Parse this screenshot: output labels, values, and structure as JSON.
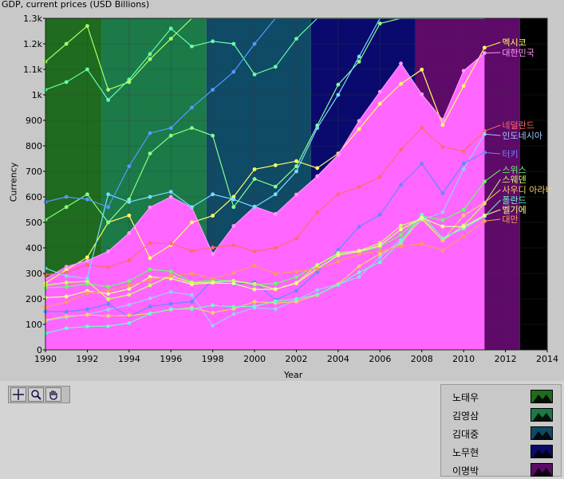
{
  "chart_data": {
    "type": "line",
    "title": "GDP, current prices (USD Billions)",
    "xlabel": "Year",
    "ylabel": "Currency",
    "xlim": [
      1990,
      2014
    ],
    "ylim": [
      0,
      1300
    ],
    "x_ticks": [
      "1990",
      "1992",
      "1994",
      "1996",
      "1998",
      "2000",
      "2002",
      "2004",
      "2006",
      "2008",
      "2010",
      "2012",
      "2014"
    ],
    "y_ticks": [
      "0",
      "100",
      "200",
      "300",
      "400",
      "500",
      "600",
      "700",
      "800",
      "900",
      "1k",
      "1.1k",
      "1.2k",
      "1.3k"
    ],
    "grid": true,
    "background_periods": [
      {
        "name": "노태우",
        "start": 1990,
        "end": 1992.7,
        "color": "#1f6b1f"
      },
      {
        "name": "김영삼",
        "start": 1992.7,
        "end": 1997.7,
        "color": "#1b7a48"
      },
      {
        "name": "김대중",
        "start": 1997.7,
        "end": 2002.7,
        "color": "#0f4a66"
      },
      {
        "name": "노무현",
        "start": 2002.7,
        "end": 2007.7,
        "color": "#0a0a6e"
      },
      {
        "name": "이명박",
        "start": 2007.7,
        "end": 2012.7,
        "color": "#5e0a68"
      },
      {
        "name": "",
        "start": 2012.7,
        "end": 2014,
        "color": "#000000"
      }
    ],
    "area_series": {
      "name": "대한민국",
      "color": "#ff66ff",
      "x": [
        1990,
        1991,
        1992,
        1993,
        1994,
        1995,
        1996,
        1997,
        1998,
        1999,
        2000,
        2001,
        2002,
        2003,
        2004,
        2005,
        2006,
        2007,
        2008,
        2009,
        2010,
        2011
      ],
      "values": [
        279,
        326,
        350,
        386,
        458,
        559,
        600,
        558,
        376,
        486,
        562,
        533,
        609,
        681,
        765,
        898,
        1012,
        1123,
        1002,
        902,
        1094,
        1164
      ]
    },
    "series": [
      {
        "name": "멕시코",
        "color": "#ffff66",
        "x": [
          1990,
          1991,
          1992,
          1993,
          1994,
          1995,
          1996,
          1997,
          1998,
          1999,
          2000,
          2001,
          2002,
          2003,
          2004,
          2005,
          2006,
          2007,
          2008,
          2009,
          2010,
          2011
        ],
        "values": [
          262,
          314,
          363,
          500,
          527,
          360,
          411,
          500,
          526,
          600,
          708,
          724,
          740,
          713,
          770,
          866,
          965,
          1043,
          1099,
          882,
          1035,
          1185
        ]
      },
      {
        "name": "대한민국",
        "color": "#ff99ff",
        "x": [
          1990,
          1991,
          1992,
          1993,
          1994,
          1995,
          1996,
          1997,
          1998,
          1999,
          2000,
          2001,
          2002,
          2003,
          2004,
          2005,
          2006,
          2007,
          2008,
          2009,
          2010,
          2011
        ],
        "values": [
          279,
          326,
          350,
          386,
          458,
          559,
          600,
          558,
          376,
          486,
          562,
          533,
          609,
          681,
          765,
          898,
          1012,
          1123,
          1002,
          902,
          1094,
          1164
        ]
      },
      {
        "name": "네덜란드",
        "color": "#ff6a6a",
        "x": [
          1990,
          1991,
          1992,
          1993,
          1994,
          1995,
          1996,
          1997,
          1998,
          1999,
          2000,
          2001,
          2002,
          2003,
          2004,
          2005,
          2006,
          2007,
          2008,
          2009,
          2010,
          2011
        ],
        "values": [
          295,
          303,
          333,
          324,
          351,
          419,
          417,
          388,
          401,
          411,
          386,
          400,
          437,
          539,
          610,
          639,
          678,
          785,
          871,
          796,
          779,
          858
        ]
      },
      {
        "name": "인도네시아",
        "color": "#99ccff",
        "x": [
          1990,
          1991,
          1992,
          1993,
          1994,
          1995,
          1996,
          1997,
          1998,
          1999,
          2000,
          2001,
          2002,
          2003,
          2004,
          2005,
          2006,
          2007,
          2008,
          2009,
          2010,
          2011
        ],
        "values": [
          114,
          128,
          139,
          158,
          177,
          202,
          227,
          215,
          95,
          140,
          165,
          160,
          196,
          235,
          257,
          286,
          364,
          432,
          510,
          540,
          709,
          846
        ]
      },
      {
        "name": "터키",
        "color": "#6688ff",
        "x": [
          1990,
          1991,
          1992,
          1993,
          1994,
          1995,
          1996,
          1997,
          1998,
          1999,
          2000,
          2001,
          2002,
          2003,
          2004,
          2005,
          2006,
          2007,
          2008,
          2009,
          2010,
          2011
        ],
        "values": [
          150,
          150,
          159,
          180,
          131,
          170,
          181,
          189,
          275,
          256,
          266,
          196,
          232,
          305,
          392,
          483,
          530,
          647,
          730,
          614,
          731,
          774
        ]
      },
      {
        "name": "스위스",
        "color": "#66ff66",
        "x": [
          1990,
          1991,
          1992,
          1993,
          1994,
          1995,
          1996,
          1997,
          1998,
          1999,
          2000,
          2001,
          2002,
          2003,
          2004,
          2005,
          2006,
          2007,
          2008,
          2009,
          2010,
          2011
        ],
        "values": [
          244,
          247,
          259,
          248,
          270,
          316,
          308,
          265,
          274,
          270,
          256,
          260,
          286,
          334,
          374,
          384,
          404,
          451,
          524,
          509,
          550,
          660
        ]
      },
      {
        "name": "스웨덴",
        "color": "#ccff66",
        "x": [
          1990,
          1991,
          1992,
          1993,
          1994,
          1995,
          1996,
          1997,
          1998,
          1999,
          2000,
          2001,
          2002,
          2003,
          2004,
          2005,
          2006,
          2007,
          2008,
          2009,
          2010,
          2011
        ],
        "values": [
          253,
          264,
          269,
          199,
          216,
          253,
          291,
          263,
          266,
          271,
          259,
          238,
          263,
          332,
          380,
          389,
          419,
          487,
          513,
          429,
          488,
          574
        ]
      },
      {
        "name": "사우디 아라비",
        "color": "#ffcc66",
        "x": [
          1990,
          1991,
          1992,
          1993,
          1994,
          1995,
          1996,
          1997,
          1998,
          1999,
          2000,
          2001,
          2002,
          2003,
          2004,
          2005,
          2006,
          2007,
          2008,
          2009,
          2010,
          2011
        ],
        "values": [
          117,
          132,
          137,
          133,
          135,
          143,
          158,
          165,
          146,
          161,
          189,
          184,
          189,
          215,
          258,
          328,
          377,
          416,
          520,
          429,
          527,
          577
        ]
      },
      {
        "name": "폴란드",
        "color": "#66ffcc",
        "x": [
          1990,
          1991,
          1992,
          1993,
          1994,
          1995,
          1996,
          1997,
          1998,
          1999,
          2000,
          2001,
          2002,
          2003,
          2004,
          2005,
          2006,
          2007,
          2008,
          2009,
          2010,
          2011
        ],
        "values": [
          65,
          85,
          92,
          93,
          105,
          142,
          160,
          160,
          175,
          169,
          171,
          191,
          199,
          217,
          255,
          304,
          344,
          425,
          530,
          438,
          476,
          524
        ]
      },
      {
        "name": "벨기에",
        "color": "#eeff88",
        "x": [
          1990,
          1991,
          1992,
          1993,
          1994,
          1995,
          1996,
          1997,
          1998,
          1999,
          2000,
          2001,
          2002,
          2003,
          2004,
          2005,
          2006,
          2007,
          2008,
          2009,
          2010,
          2011
        ],
        "values": [
          205,
          209,
          231,
          220,
          239,
          286,
          280,
          257,
          263,
          260,
          237,
          238,
          261,
          318,
          371,
          386,
          409,
          472,
          518,
          484,
          483,
          527
        ]
      },
      {
        "name": "대만",
        "color": "#ff9966",
        "x": [
          1990,
          1991,
          1992,
          1993,
          1994,
          1995,
          1996,
          1997,
          1998,
          1999,
          2000,
          2001,
          2002,
          2003,
          2004,
          2005,
          2006,
          2007,
          2008,
          2009,
          2010,
          2011
        ],
        "values": [
          167,
          187,
          222,
          233,
          253,
          275,
          290,
          300,
          279,
          303,
          331,
          299,
          307,
          317,
          346,
          375,
          388,
          406,
          416,
          390,
          446,
          505
        ]
      },
      {
        "name": "",
        "color": "#88ff88",
        "x": [
          1990,
          1991,
          1992,
          1993,
          1994,
          1995,
          1996,
          1997,
          1998,
          1999,
          2000,
          2001,
          2002,
          2003,
          2004,
          2005,
          2006,
          2007,
          2008,
          2009,
          2010,
          2011
        ],
        "values": [
          510,
          560,
          610,
          500,
          590,
          770,
          840,
          870,
          840,
          560,
          670,
          640,
          720,
          880,
          1040,
          1130,
          1280,
          1300,
          1300,
          1300,
          1300,
          1300
        ]
      },
      {
        "name": "",
        "color": "#77ddff",
        "x": [
          1990,
          1991,
          1992,
          1993,
          1994,
          1995,
          1996,
          1997,
          1998,
          1999,
          2000,
          2001,
          2002,
          2003,
          2004,
          2005,
          2006,
          2007,
          2008,
          2009,
          2010,
          2011
        ],
        "values": [
          320,
          290,
          280,
          610,
          580,
          600,
          620,
          560,
          610,
          590,
          560,
          610,
          700,
          870,
          1000,
          1150,
          1300,
          1300,
          1300,
          1300,
          1300,
          1300
        ]
      },
      {
        "name": "",
        "color": "#66ffaa",
        "x": [
          1990,
          1991,
          1992,
          1993,
          1994,
          1995,
          1996,
          1997,
          1998,
          1999,
          2000,
          2001,
          2002,
          2003,
          2004,
          2005,
          2006,
          2007,
          2008,
          2009,
          2010,
          2011
        ],
        "values": [
          1020,
          1050,
          1100,
          980,
          1060,
          1160,
          1260,
          1190,
          1210,
          1200,
          1080,
          1110,
          1220,
          1300,
          1300,
          1300,
          1300,
          1300,
          1300,
          1300,
          1300,
          1300
        ]
      },
      {
        "name": "",
        "color": "#aaff66",
        "x": [
          1990,
          1991,
          1992,
          1993,
          1994,
          1995,
          1996,
          1997,
          1998,
          1999,
          2000,
          2001,
          2002,
          2003,
          2004,
          2005,
          2006,
          2007,
          2008,
          2009,
          2010,
          2011
        ],
        "values": [
          1130,
          1200,
          1270,
          1020,
          1050,
          1140,
          1220,
          1300,
          1300,
          1300,
          1300,
          1300,
          1300,
          1300,
          1300,
          1300,
          1300,
          1300,
          1300,
          1300,
          1300,
          1300
        ]
      },
      {
        "name": "",
        "color": "#5599ff",
        "x": [
          1990,
          1991,
          1992,
          1993,
          1994,
          1995,
          1996,
          1997,
          1998,
          1999,
          2000,
          2001,
          2002,
          2003,
          2004,
          2005,
          2006,
          2007,
          2008,
          2009,
          2010,
          2011
        ],
        "values": [
          580,
          600,
          590,
          560,
          720,
          850,
          870,
          950,
          1020,
          1090,
          1200,
          1300,
          1300,
          1300,
          1300,
          1300,
          1300,
          1300,
          1300,
          1300,
          1300,
          1300
        ]
      }
    ],
    "legend": [
      {
        "name": "노태우",
        "color": "#1f6b1f"
      },
      {
        "name": "김영삼",
        "color": "#1b7a48"
      },
      {
        "name": "김대중",
        "color": "#0f4a66"
      },
      {
        "name": "노무현",
        "color": "#0a0a6e"
      },
      {
        "name": "이명박",
        "color": "#5e0a68"
      }
    ],
    "legend_position": "bottom-right"
  }
}
